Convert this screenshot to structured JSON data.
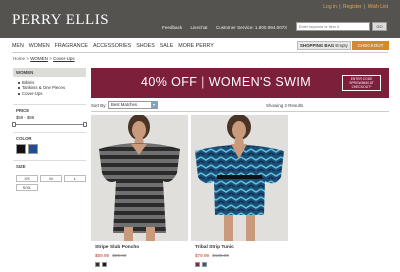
{
  "brand": {
    "logo": "PERRY ELLIS"
  },
  "top_links": {
    "login": "Log in",
    "register": "Register",
    "wish_list": "Wish List",
    "sep": "|"
  },
  "utility": {
    "feedback": "Feedback",
    "livechat": "Livechat",
    "customer_service": "Customer Service: 1.800.994.0073"
  },
  "search": {
    "placeholder": "Enter keyword or item #",
    "go": "GO"
  },
  "nav": {
    "items": [
      "MEN",
      "WOMEN",
      "FRAGRANCE",
      "ACCESSORIES",
      "SHOES",
      "SALE",
      "MORE PERRY"
    ]
  },
  "bag": {
    "label": "SHOPPING BAG",
    "status": "Empty",
    "checkout": "CHECKOUT"
  },
  "breadcrumb": {
    "home": "Home",
    "sep": ">",
    "women": "WOMEN",
    "current": "Cover-Ups"
  },
  "sidebar": {
    "category": "WOMEN",
    "items": [
      "Bikinis",
      "Tankinis & One Pieces",
      "Cover-Ups"
    ],
    "price_label": "PRICE",
    "price_range": "$59 - $89",
    "color_label": "COLOR",
    "colors": [
      "#111111",
      "#1f4f8f"
    ],
    "size_label": "SIZE",
    "sizes": [
      "XS",
      "M",
      "L",
      "S/XL"
    ]
  },
  "banner": {
    "text_left": "40% OFF",
    "text_bar": "|",
    "text_right": "WOMEN'S SWIM",
    "code": "ENTER CODE SPRGWIM40 AT CHECKOUT*",
    "bg": "#7b1f3a"
  },
  "sort": {
    "label": "Sort By:",
    "value": "Best Matches"
  },
  "results": {
    "showing": "Showing 2 Results"
  },
  "products": [
    {
      "name": "Stripe Slub Poncho",
      "sale_price": "$59.99",
      "orig_price": "$89.00",
      "swatches": [
        "#3a2d2d",
        "#1a1a1a"
      ]
    },
    {
      "name": "Tribal Strip Tunic",
      "sale_price": "$79.99",
      "orig_price": "$135.00",
      "swatches": [
        "#7a2d3a",
        "#2a5c8a"
      ]
    }
  ]
}
